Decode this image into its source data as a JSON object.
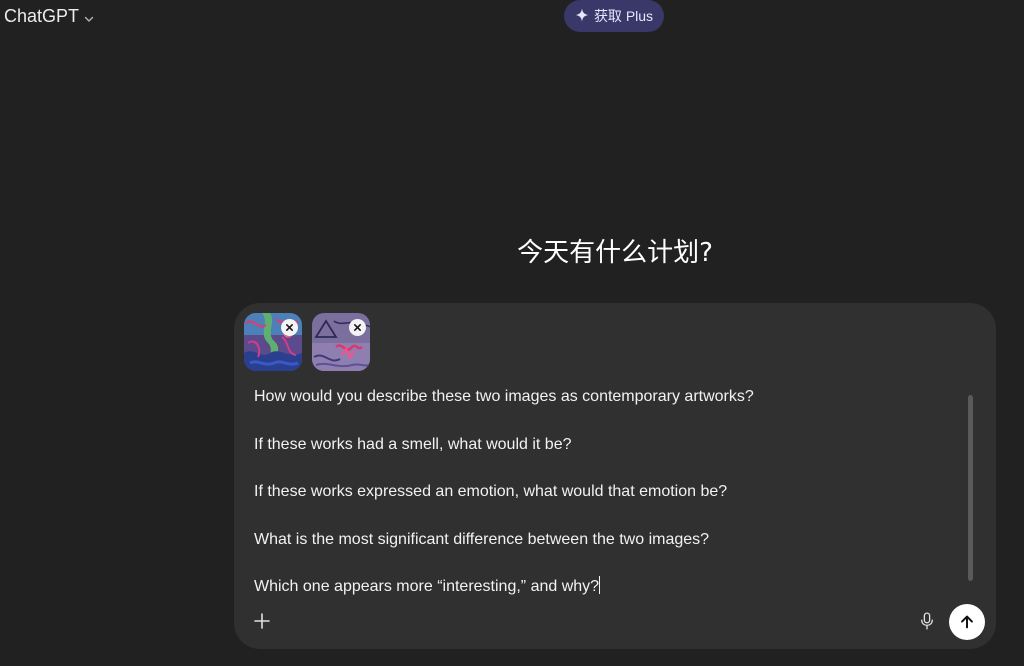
{
  "header": {
    "model_name": "ChatGPT",
    "model_icon": "chevron-down-icon",
    "upgrade_label": "获取 Plus",
    "upgrade_icon": "sparkle-icon",
    "upgrade_color": "#393869"
  },
  "main": {
    "greeting": "今天有什么计划?"
  },
  "composer": {
    "attachments": [
      {
        "name": "image-attachment-1",
        "remove_icon": "close-icon"
      },
      {
        "name": "image-attachment-2",
        "remove_icon": "close-icon"
      }
    ],
    "prompt_lines": [
      "How would you describe these two images as contemporary artworks?",
      "",
      "If these works had a smell, what would it be?",
      "",
      "If these works expressed an emotion, what would that emotion be?",
      "",
      "What is the most significant difference between the two images?",
      "",
      "Which one appears more “interesting,” and why?"
    ],
    "add_icon": "plus-icon",
    "mic_icon": "microphone-icon",
    "send_icon": "arrow-up-icon"
  }
}
